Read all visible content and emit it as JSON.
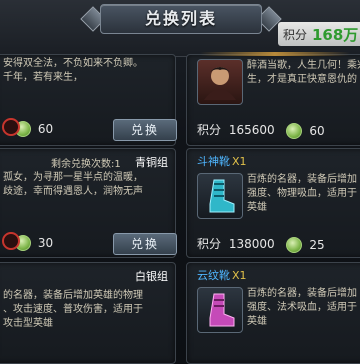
{
  "header": {
    "title": "兑换列表",
    "points_label": "积分",
    "points_value": "168万"
  },
  "cards": [
    {
      "desc": "…安得双全法，不负如来不负卿。…千年，若有来生……",
      "desc_lines": [
        "安得双全法，不负如来不负卿。",
        "千年，若有来生，"
      ],
      "coin_value": "60",
      "button": "兑换"
    },
    {
      "desc_lines": [
        "醉酒当歌，人生几何！乘兴",
        "生，才是真正快意恩仇的"
      ],
      "points_label": "积分",
      "points_value": "165600",
      "coin_value": "60"
    },
    {
      "remaining": "剩余兑换次数:1",
      "tier": "青铜组",
      "desc_lines": [
        "孤女，为寻那一星半点的温暖，",
        "歧途，幸而得遇恩人，润物无声"
      ],
      "coin_value": "30",
      "button": "兑换"
    },
    {
      "name": "斗神靴",
      "qty": "X1",
      "desc_lines": [
        "百炼的名器，装备后增加",
        "强度、物理吸血，适用于",
        "英雄"
      ],
      "points_label": "积分",
      "points_value": "138000",
      "coin_value": "25"
    },
    {
      "tier": "白银组",
      "desc_lines": [
        "的名器，装备后增加英雄的物理",
        "、攻击速度、普攻伤害，适用于",
        "攻击型英雄"
      ]
    },
    {
      "name": "云纹靴",
      "qty": "X1",
      "desc_lines": [
        "百炼的名器，装备后增加",
        "强度、法术吸血，适用于",
        "英雄"
      ]
    }
  ],
  "colors": {
    "accent_blue": "#4fb6ff",
    "points_green": "#2f9a2f",
    "qty_gold": "#e0c04a"
  },
  "icons": [
    "shield-icon",
    "avatar",
    "coin-icon",
    "boots-icon",
    "red-ring-icon"
  ]
}
